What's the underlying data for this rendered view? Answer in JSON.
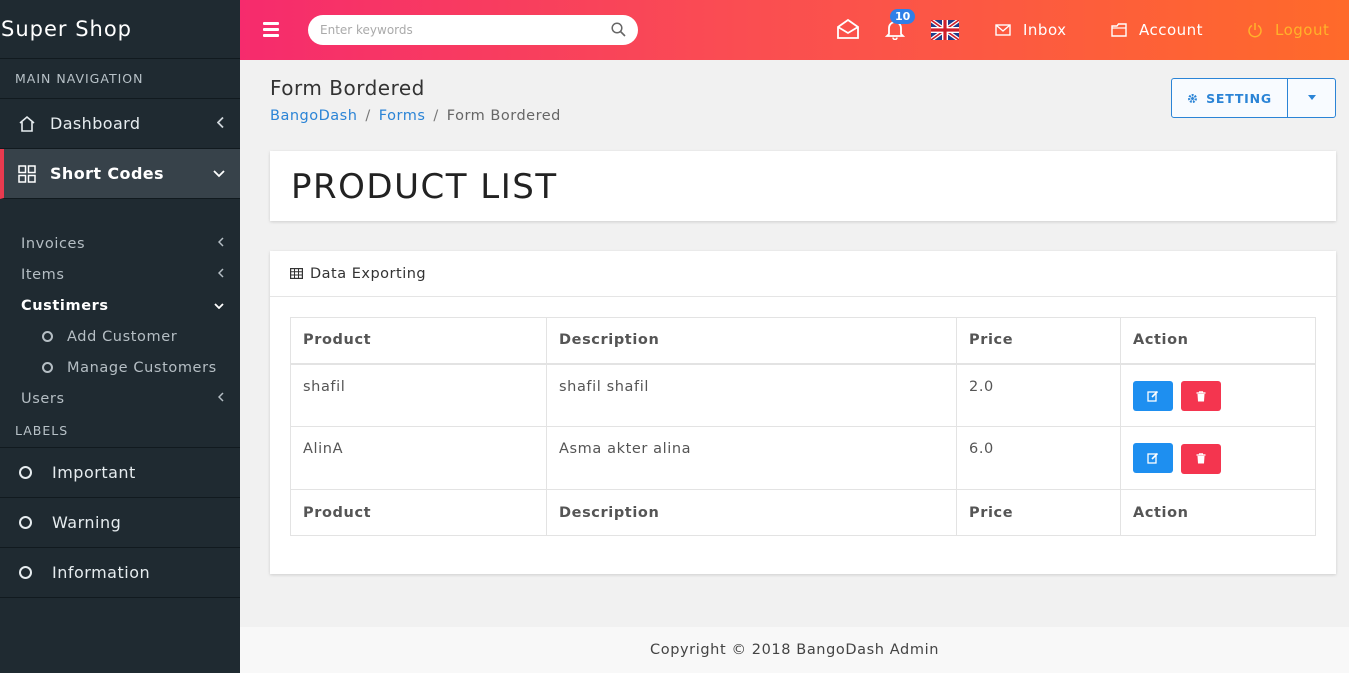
{
  "sidebar": {
    "brand": "Super Shop",
    "nav_header": "MAIN NAVIGATION",
    "items": [
      {
        "label": "Dashboard",
        "icon": "home-icon"
      },
      {
        "label": "Short Codes",
        "icon": "grid-icon"
      }
    ],
    "sub_items": [
      {
        "label": "Invoices"
      },
      {
        "label": "Items"
      },
      {
        "label": "Custimers"
      },
      {
        "label": "Add Customer"
      },
      {
        "label": "Manage Customers"
      },
      {
        "label": "Users"
      }
    ],
    "labels_header": "LABELS",
    "labels": [
      {
        "label": "Important"
      },
      {
        "label": "Warning"
      },
      {
        "label": "Information"
      }
    ]
  },
  "topbar": {
    "search_placeholder": "Enter keywords",
    "notification_count": "10",
    "inbox": "Inbox",
    "account": "Account",
    "logout": "Logout"
  },
  "page": {
    "title": "Form Bordered",
    "breadcrumb": [
      "BangoDash",
      "Forms",
      "Form Bordered"
    ],
    "setting_label": "SETTING",
    "heading": "PRODUCT LIST",
    "card_title": "Data Exporting"
  },
  "table": {
    "headers": [
      "Product",
      "Description",
      "Price",
      "Action"
    ],
    "rows": [
      {
        "product": "shafil",
        "description": "shafil shafil",
        "price": "2.0"
      },
      {
        "product": "AlinA",
        "description": "Asma akter alina",
        "price": "6.0"
      }
    ],
    "footers": [
      "Product",
      "Description",
      "Price",
      "Action"
    ]
  },
  "footer": {
    "text": "Copyright © 2018 BangoDash Admin"
  },
  "colors": {
    "accent": "#2b84d6",
    "sidebar_bg": "#1f2a31",
    "topbar_start": "#f62b6d",
    "topbar_end": "#ff6a2a",
    "edit_button": "#1e8ff0",
    "delete_button": "#f4354f"
  }
}
